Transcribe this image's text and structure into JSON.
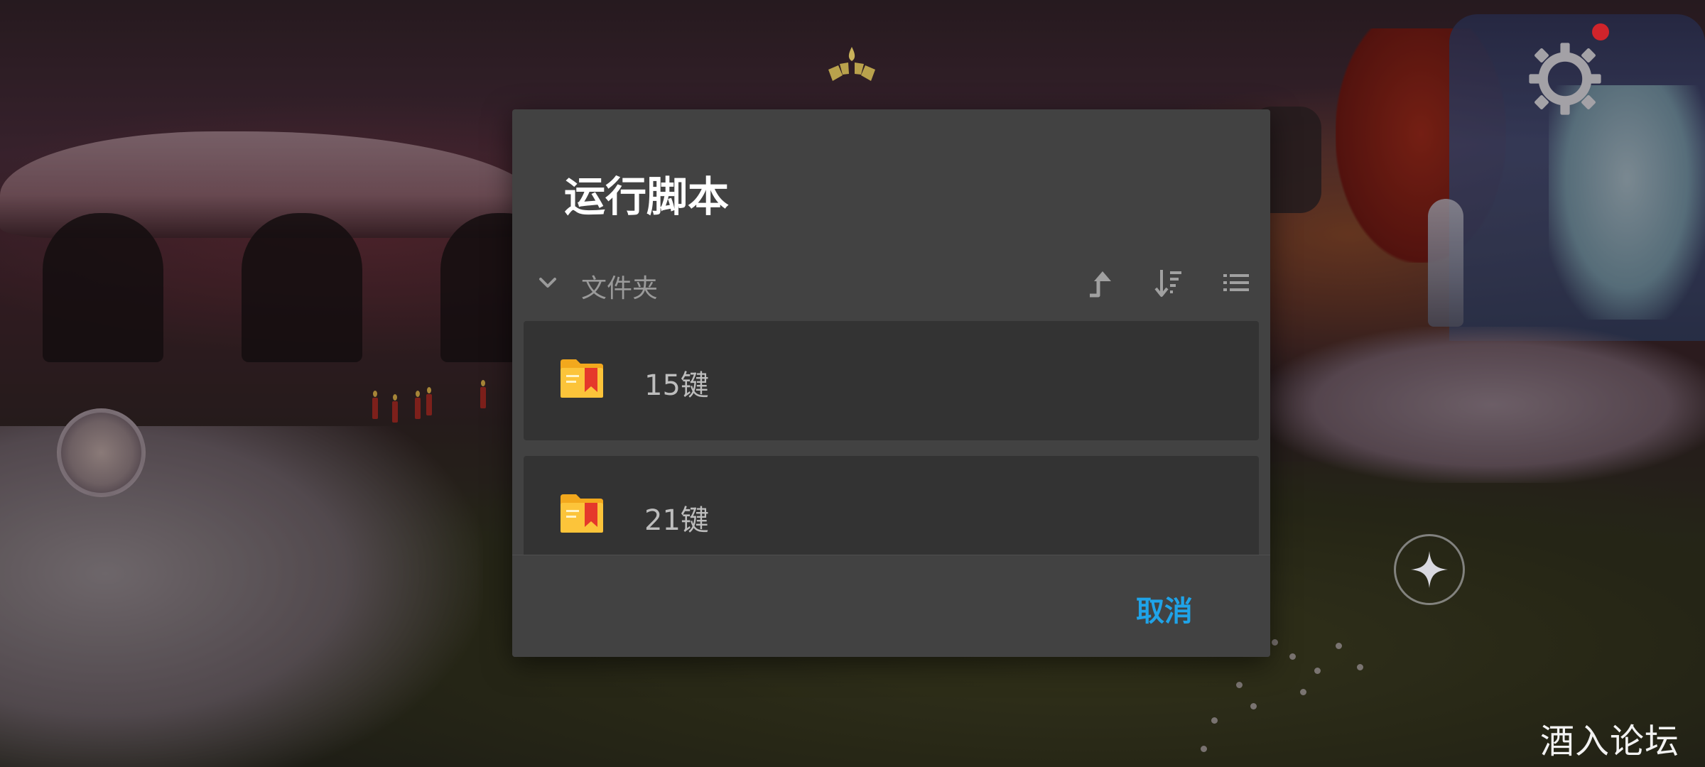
{
  "dialog": {
    "title": "运行脚本",
    "folder_label": "文件夹",
    "toolbar_icons": [
      "go-up-icon",
      "sort-icon",
      "list-view-icon"
    ],
    "items": [
      {
        "label": "15键",
        "icon": "folder-icon"
      },
      {
        "label": "21键",
        "icon": "folder-icon"
      }
    ],
    "cancel_label": "取消"
  },
  "hud": {
    "icons": [
      "candle-fan-icon",
      "settings-gear-icon",
      "notification-dot",
      "avatar",
      "star-emote-icon"
    ]
  },
  "watermark": "酒入论坛",
  "colors": {
    "dialog_bg": "#424242",
    "row_bg": "#333333",
    "accent": "#1fa3e8",
    "folder_yellow": "#f7b529",
    "folder_red": "#e5382b"
  }
}
